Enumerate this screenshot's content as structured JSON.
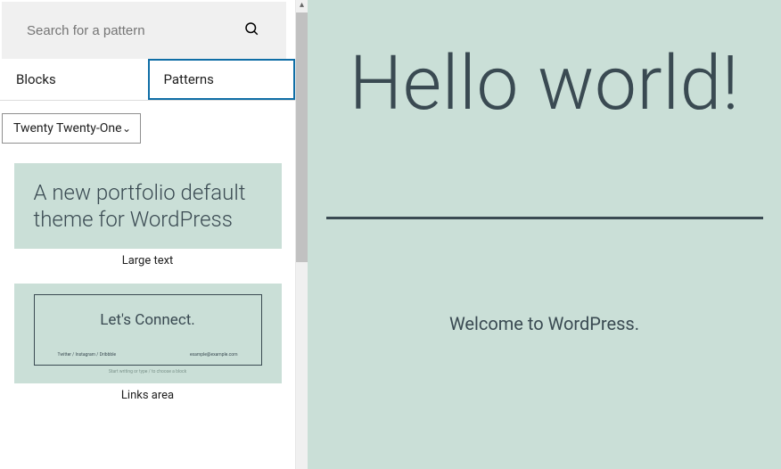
{
  "search": {
    "placeholder": "Search for a pattern"
  },
  "tabs": {
    "blocks": "Blocks",
    "patterns": "Patterns",
    "active": "patterns"
  },
  "theme_select": {
    "label": "Twenty Twenty-One"
  },
  "patterns": [
    {
      "caption": "Large text",
      "thumb_text": "A new portfolio default theme for WordPress"
    },
    {
      "caption": "Links area",
      "thumb_title": "Let's Connect.",
      "thumb_meta_left": "Twitter / Instagram / Dribbble",
      "thumb_meta_right": "example@example.com",
      "thumb_footer": "Start writing or type / to choose a block"
    }
  ],
  "preview": {
    "title": "Hello world!",
    "welcome": "Welcome to WordPress."
  }
}
